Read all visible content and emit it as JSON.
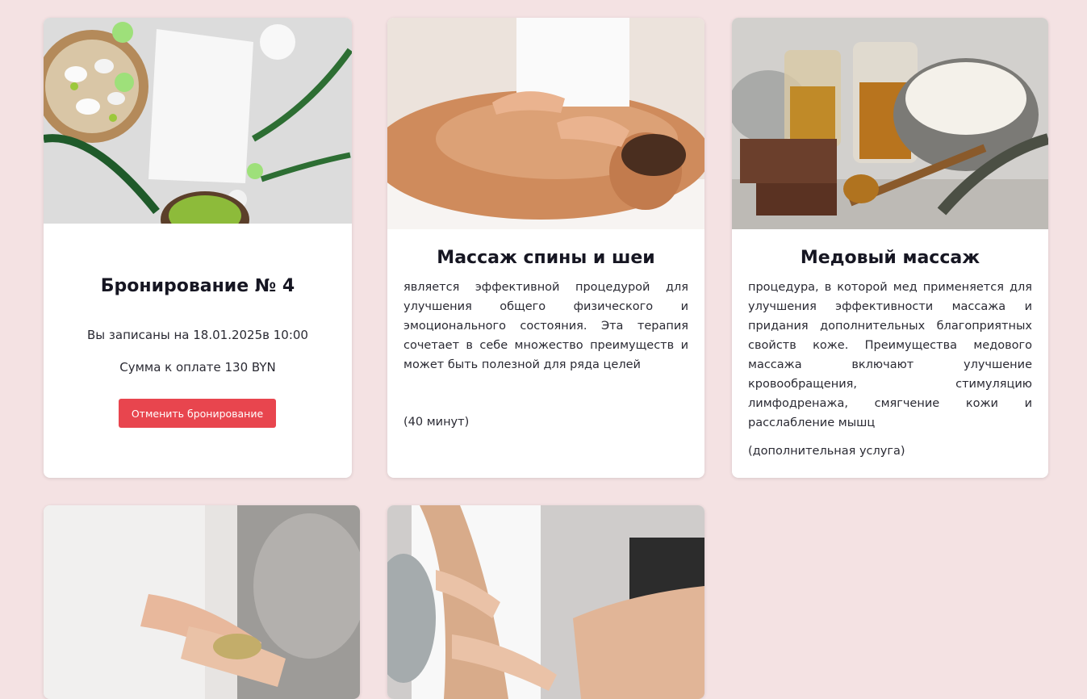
{
  "booking": {
    "title": "Бронирование № 4",
    "date_text": "Вы записаны на 18.01.2025в 10:00",
    "sum_text": "Сумма к оплате 130 BYN",
    "cancel_label": "Отменить бронирование"
  },
  "services": [
    {
      "title": "Массаж спины и шеи",
      "description": "является эффективной процедурой для улучшения общего физического и эмоционального состояния. Эта терапия сочетает в себе множество преимуществ и может быть полезной для ряда целей",
      "note": "(40 минут)"
    },
    {
      "title": "Медовый массаж",
      "description": "процедура, в которой мед применяется для улучшения эффективности массажа и придания дополнительных благоприятных свойств коже. Преимущества медового массажа включают улучшение кровообращения, стимуляцию лимфодренажа, смягчение кожи и расслабление мышц",
      "note": "(дополнительная услуга)"
    }
  ],
  "colors": {
    "page_background": "#f4e2e3",
    "card_background": "#ffffff",
    "cancel_button": "#e8454e"
  }
}
